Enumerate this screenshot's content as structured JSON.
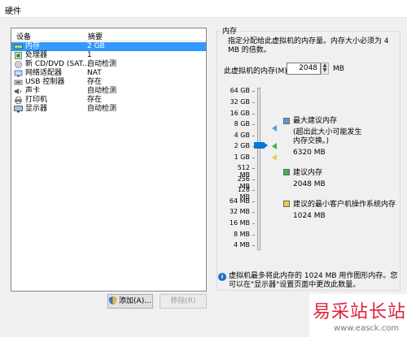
{
  "window": {
    "title": "硬件"
  },
  "device_list": {
    "headers": {
      "device": "设备",
      "summary": "摘要"
    },
    "items": [
      {
        "name": "内存",
        "summary": "2 GB",
        "icon": "memory-icon",
        "selected": true
      },
      {
        "name": "处理器",
        "summary": "1",
        "icon": "cpu-icon"
      },
      {
        "name": "新 CD/DVD (SAT...",
        "summary": "自动检测",
        "icon": "cd-icon"
      },
      {
        "name": "网络适配器",
        "summary": "NAT",
        "icon": "network-icon"
      },
      {
        "name": "USB 控制器",
        "summary": "存在",
        "icon": "usb-icon"
      },
      {
        "name": "声卡",
        "summary": "自动检测",
        "icon": "sound-icon"
      },
      {
        "name": "打印机",
        "summary": "存在",
        "icon": "printer-icon"
      },
      {
        "name": "显示器",
        "summary": "自动检测",
        "icon": "monitor-icon"
      }
    ]
  },
  "buttons": {
    "add": "添加(A)...",
    "remove": "移除(R)"
  },
  "memory": {
    "group_title": "内存",
    "description": "指定分配给此虚拟机的内存量。内存大小必须为 4 MB 的倍数。",
    "field_label": "此虚拟机的内存(M):",
    "value": "2048",
    "unit": "MB",
    "ticks": [
      "64 GB",
      "32 GB",
      "16 GB",
      "8 GB",
      "4 GB",
      "2 GB",
      "1 GB",
      "512 MB",
      "256 MB",
      "128 MB",
      "64 MB",
      "32 MB",
      "16 MB",
      "8 MB",
      "4 MB"
    ],
    "slider_value_mb": 2048,
    "legend": {
      "max_title": "最大建议内存",
      "max_note": "(超出此大小可能发生内存交换。)",
      "max_value": "6320 MB",
      "rec_title": "建议内存",
      "rec_value": "2048 MB",
      "min_title": "建议的最小客户机操作系统内存",
      "min_value": "1024 MB"
    },
    "info_text": "虚拟机最多将此内存的 1024 MB 用作图形内存。您可以在\"显示器\"设置页面中更改此数量。",
    "colors": {
      "max": "#5b9bd5",
      "rec": "#3cb44b",
      "min": "#e8d044"
    }
  },
  "watermark": {
    "text": "易采站长站",
    "url": "www.easck.com"
  }
}
